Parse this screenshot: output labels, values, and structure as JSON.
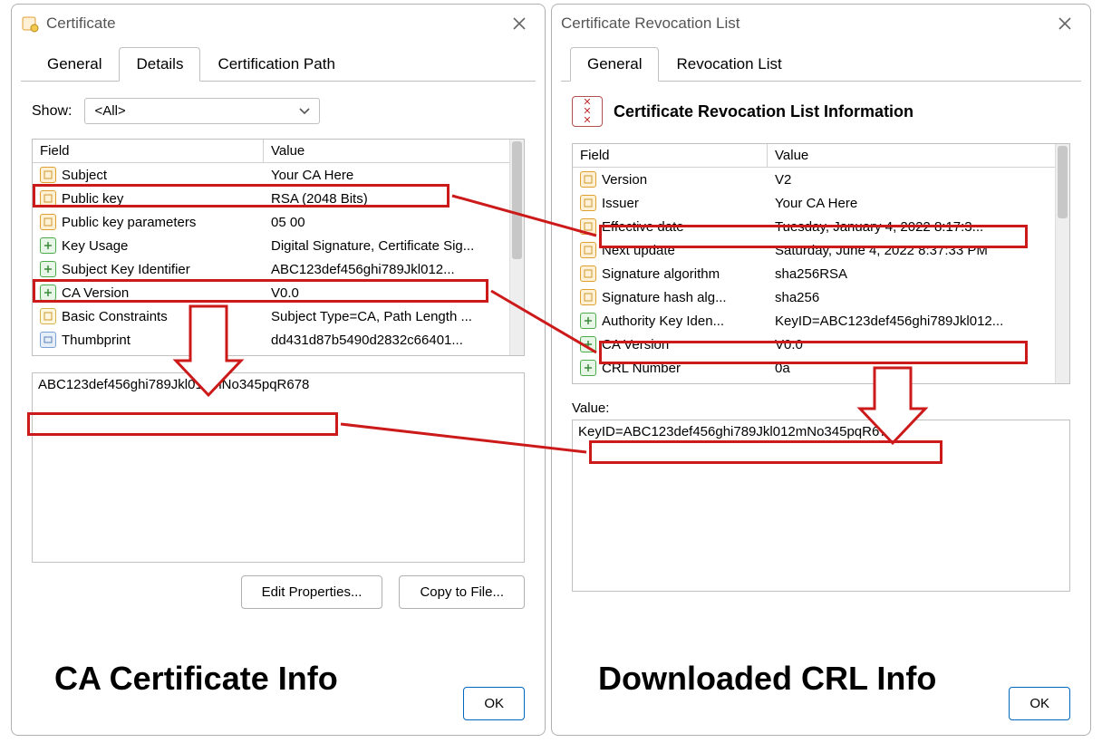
{
  "left": {
    "title": "Certificate",
    "tabs": [
      "General",
      "Details",
      "Certification Path"
    ],
    "active_tab": "Details",
    "show_label": "Show:",
    "show_value": "<All>",
    "headers": {
      "field": "Field",
      "value": "Value"
    },
    "rows": [
      {
        "icon": "prop",
        "field": "Subject",
        "value": "Your CA Here"
      },
      {
        "icon": "prop",
        "field": "Public key",
        "value": "RSA (2048 Bits)"
      },
      {
        "icon": "prop",
        "field": "Public key parameters",
        "value": "05 00"
      },
      {
        "icon": "ext",
        "field": "Key Usage",
        "value": "Digital Signature, Certificate Sig..."
      },
      {
        "icon": "ext",
        "field": "Subject Key Identifier",
        "value": "ABC123def456ghi789Jkl012..."
      },
      {
        "icon": "ext",
        "field": "CA Version",
        "value": "V0.0"
      },
      {
        "icon": "constraint",
        "field": "Basic Constraints",
        "value": "Subject Type=CA, Path Length ..."
      },
      {
        "icon": "thumb",
        "field": "Thumbprint",
        "value": "dd431d87b5490d2832c66401..."
      }
    ],
    "detail_value": "ABC123def456ghi789Jkl012mNo345pqR678",
    "buttons": {
      "edit": "Edit Properties...",
      "copy": "Copy to File..."
    },
    "ok": "OK",
    "caption": "CA Certificate Info"
  },
  "right": {
    "title": "Certificate Revocation List",
    "tabs": [
      "General",
      "Revocation List"
    ],
    "active_tab": "General",
    "banner": "Certificate Revocation List Information",
    "headers": {
      "field": "Field",
      "value": "Value"
    },
    "rows": [
      {
        "icon": "prop",
        "field": "Version",
        "value": "V2"
      },
      {
        "icon": "prop",
        "field": "Issuer",
        "value": "Your CA Here"
      },
      {
        "icon": "prop",
        "field": "Effective date",
        "value": "Tuesday, January 4, 2022 8:17:3..."
      },
      {
        "icon": "prop",
        "field": "Next update",
        "value": "Saturday, June 4, 2022 8:37:33 PM"
      },
      {
        "icon": "prop",
        "field": "Signature algorithm",
        "value": "sha256RSA"
      },
      {
        "icon": "prop",
        "field": "Signature hash alg...",
        "value": "sha256"
      },
      {
        "icon": "ext",
        "field": "Authority Key Iden...",
        "value": "KeyID=ABC123def456ghi789Jkl012..."
      },
      {
        "icon": "ext",
        "field": "CA Version",
        "value": "V0.0"
      },
      {
        "icon": "ext",
        "field": "CRL Number",
        "value": "0a"
      }
    ],
    "value_label": "Value:",
    "detail_value": "KeyID=ABC123def456ghi789Jkl012mNo345pqR678",
    "ok": "OK",
    "caption": "Downloaded CRL Info"
  },
  "annotation_color": "#cc1a1a"
}
